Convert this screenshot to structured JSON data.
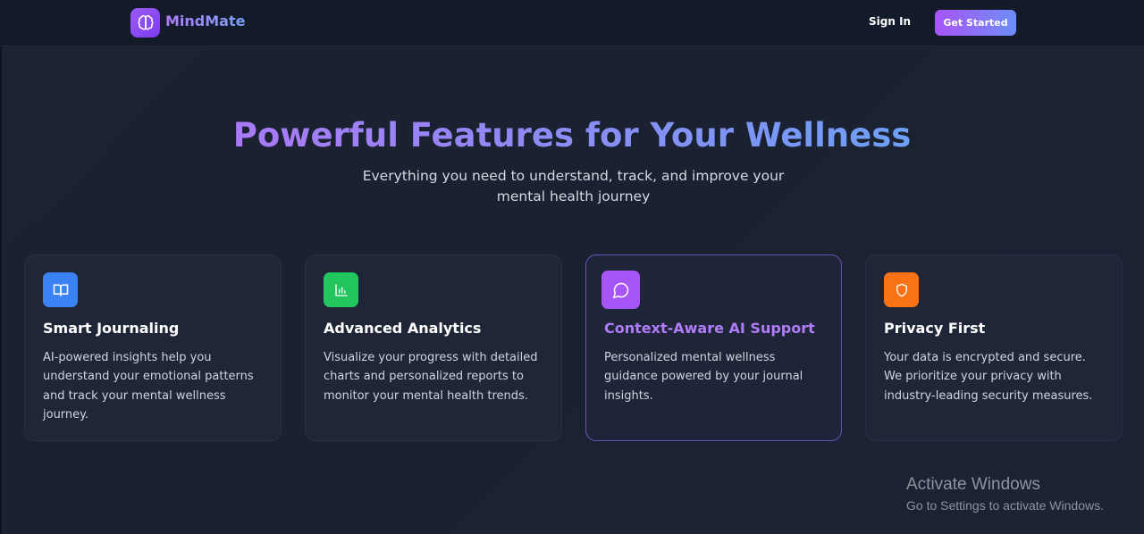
{
  "nav": {
    "brand": "MindMate",
    "signin_label": "Sign In",
    "cta_label": "Get Started",
    "logo_icon": "brain-icon"
  },
  "hero": {
    "title": "Powerful Features for Your Wellness",
    "subtitle": "Everything you need to understand, track, and improve your mental health journey"
  },
  "features": [
    {
      "title": "Smart Journaling",
      "description": "AI-powered insights help you understand your emotional patterns and track your mental wellness journey.",
      "icon": "book-icon",
      "color": "#3b82f6"
    },
    {
      "title": "Advanced Analytics",
      "description": "Visualize your progress with detailed charts and personalized reports to monitor your mental health trends.",
      "icon": "bar-chart-icon",
      "color": "#22c55e"
    },
    {
      "title": "Context-Aware AI Support",
      "description": "Personalized mental wellness guidance powered by your journal insights.",
      "icon": "chat-bubble-icon",
      "color": "#a855f7"
    },
    {
      "title": "Privacy First",
      "description": "Your data is encrypted and secure. We prioritize your privacy with industry-leading security measures.",
      "icon": "shield-icon",
      "color": "#f97316"
    }
  ],
  "watermark": {
    "line1": "Activate Windows",
    "line2": "Go to Settings to activate Windows."
  }
}
